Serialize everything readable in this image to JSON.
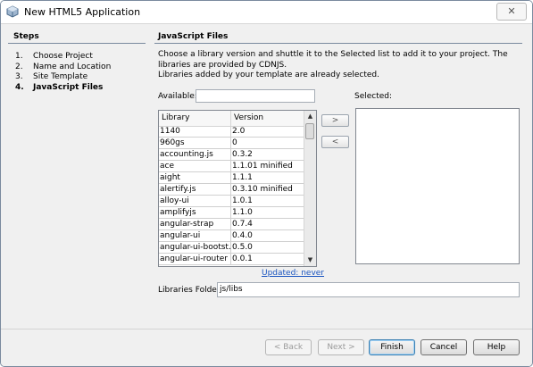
{
  "window": {
    "title": "New HTML5 Application",
    "close_glyph": "✕"
  },
  "steps": {
    "header": "Steps",
    "items": [
      {
        "num": "1.",
        "label": "Choose Project"
      },
      {
        "num": "2.",
        "label": "Name and Location"
      },
      {
        "num": "3.",
        "label": "Site Template"
      },
      {
        "num": "4.",
        "label": "JavaScript Files",
        "current": true
      }
    ]
  },
  "main": {
    "header": "JavaScript Files",
    "description_line1": "Choose a library version and shuttle it to the Selected list to add it to your project. The libraries are provided by CDNJS.",
    "description_line2": "Libraries added by your template are already selected.",
    "available_label": "Available:",
    "available_value": "",
    "selected_label": "Selected:",
    "table": {
      "columns": [
        "Library",
        "Version"
      ],
      "rows": [
        [
          "1140",
          "2.0"
        ],
        [
          "960gs",
          "0"
        ],
        [
          "accounting.js",
          "0.3.2"
        ],
        [
          "ace",
          "1.1.01 minified"
        ],
        [
          "aight",
          "1.1.1"
        ],
        [
          "alertify.js",
          "0.3.10 minified"
        ],
        [
          "alloy-ui",
          "1.0.1"
        ],
        [
          "amplifyjs",
          "1.1.0"
        ],
        [
          "angular-strap",
          "0.7.4"
        ],
        [
          "angular-ui",
          "0.4.0"
        ],
        [
          "angular-ui-bootst...",
          "0.5.0"
        ],
        [
          "angular-ui-router",
          "0.0.1"
        ]
      ]
    },
    "add_button": ">",
    "remove_button": "<",
    "updated_link": "Updated: never",
    "libraries_folder_label": "Libraries Folder:",
    "libraries_folder_value": "js/libs"
  },
  "footer": {
    "back": "< Back",
    "next": "Next >",
    "finish": "Finish",
    "cancel": "Cancel",
    "help": "Help"
  },
  "icons": {
    "app": "netbeans-cube-icon",
    "scroll_up": "▲",
    "scroll_down": "▼"
  },
  "colors": {
    "link": "#1a55c0",
    "border": "#7a8a9e"
  }
}
